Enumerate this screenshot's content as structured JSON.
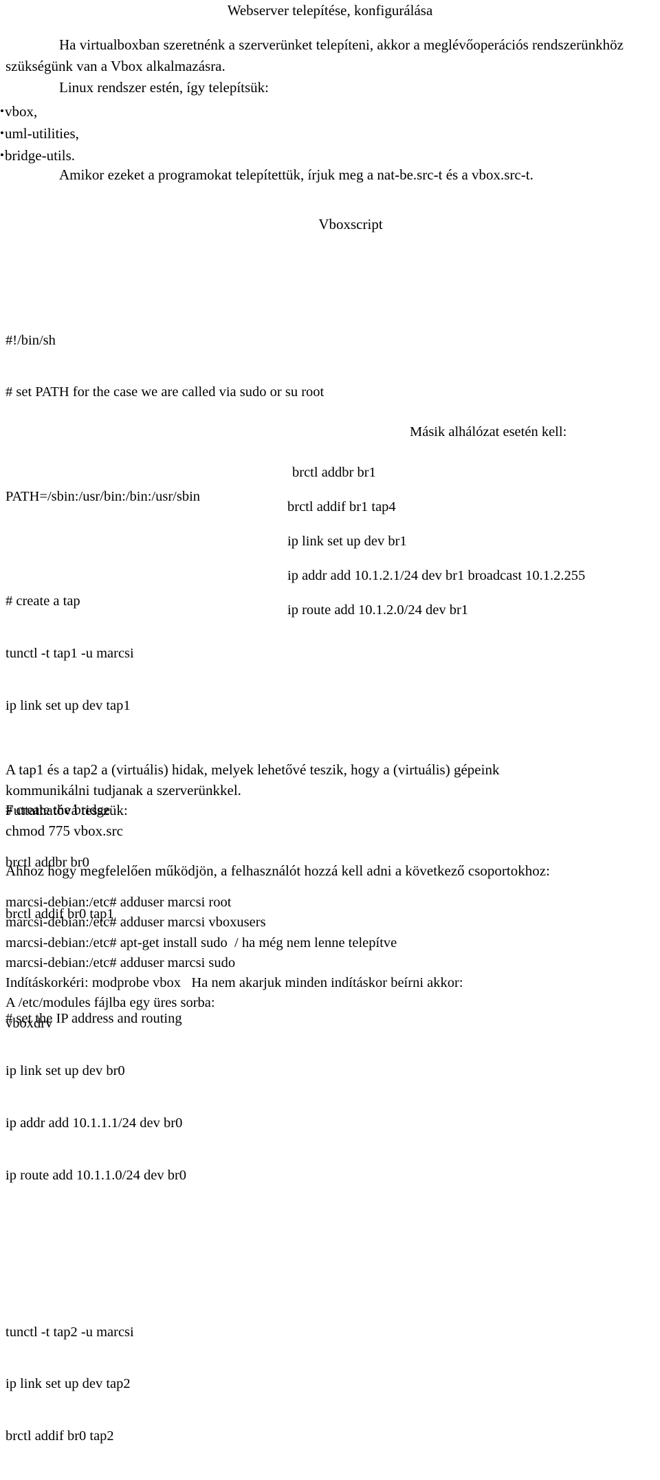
{
  "document": {
    "title": "Webserver telepítése, konfigurálása",
    "intro": {
      "paragraph1": "Ha virtualboxban szeretnénk a szerverünket telepíteni, akkor a meglévőoperációs rendszerünkhöz szükségünk van a Vbox alkalmazásra.",
      "paragraph2": "Linux rendszer estén, így telepítsük:",
      "bullet_glyph": "•",
      "packages": [
        "vbox,",
        "uml-utilities,",
        "bridge-utils."
      ],
      "paragraph3": "Amikor ezeket a programokat telepítettük, írjuk meg a nat-be.src-t és a vbox.src-t."
    },
    "script_heading": "Vboxscript",
    "script_left_column": [
      "#!/bin/sh",
      "# set PATH for the case we are called via sudo or su root",
      "",
      "PATH=/sbin:/usr/bin:/bin:/usr/sbin",
      "",
      "# create a tap",
      "tunctl -t tap1 -u marcsi",
      "ip link set up dev tap1",
      "",
      "# create the bridge",
      "brctl addbr br0",
      "brctl addif br0 tap1",
      "",
      "# set the IP address and routing",
      "ip link set up dev br0",
      "ip addr add 10.1.1.1/24 dev br0",
      "ip route add 10.1.1.0/24 dev br0",
      "",
      "tunctl -t tap2 -u marcsi",
      "ip link set up dev tap2",
      "brctl addif br0 tap2"
    ],
    "alt_subnet_heading": "Másik alhálózat esetén kell:",
    "script_right_column": [
      "brctl addbr br1",
      "brctl addif br1 tap4",
      "ip link set up dev br1",
      "ip addr add 10.1.2.1/24 dev br1 broadcast 10.1.2.255",
      "ip route add 10.1.2.0/24 dev br1"
    ],
    "closing_a": [
      "A tap1 és a tap2 a (virtuális) hidak, melyek lehetővé teszik, hogy a (virtuális) gépeink",
      "kommunikálni tudjanak a szerverünkkel.",
      "Futtathatóvá tesszük:",
      "chmod 775 vbox.src"
    ],
    "closing_b": "Ahhoz hogy megfelelően működjön, a felhasználót hozzá kell adni a következő csoportokhoz:",
    "console_lines": [
      "marcsi-debian:/etc# adduser marcsi root",
      "marcsi-debian:/etc# adduser marcsi vboxusers",
      "marcsi-debian:/etc# apt-get install sudo  / ha még nem lenne telepítve",
      "marcsi-debian:/etc# adduser marcsi sudo",
      "Indításkorkéri: modprobe vbox   Ha nem akarjuk minden indításkor beírni akkor:",
      "A /etc/modules fájlba egy üres sorba:",
      "vboxdrv"
    ]
  }
}
